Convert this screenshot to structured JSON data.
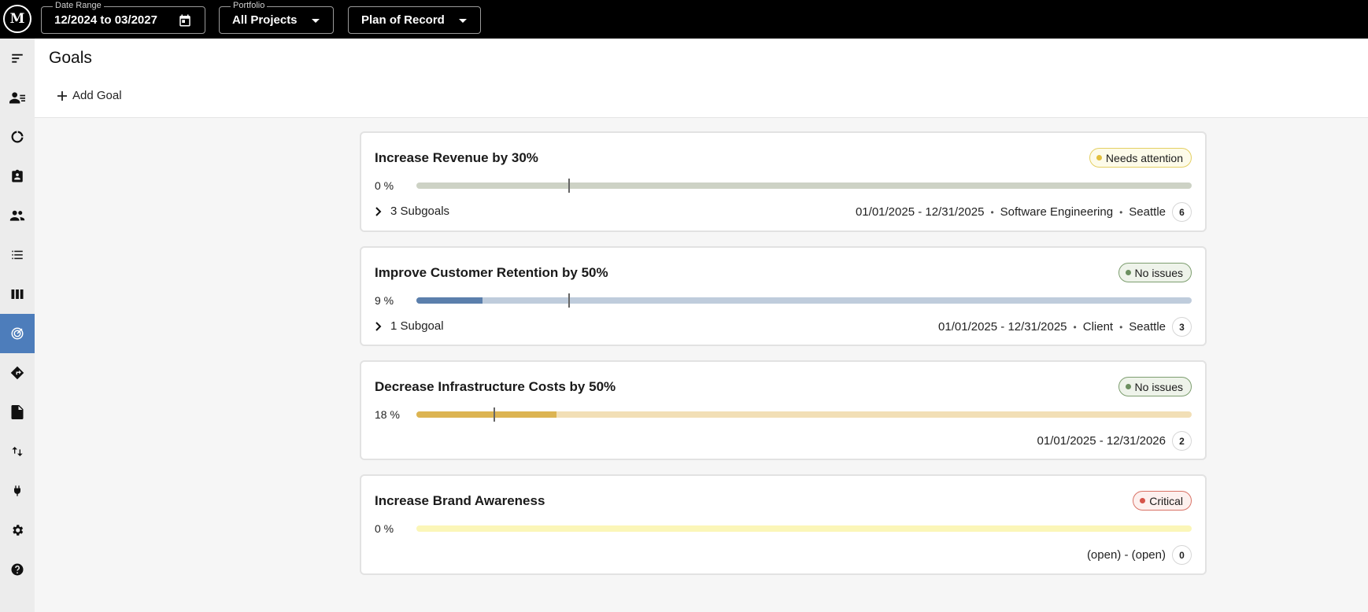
{
  "topbar": {
    "logo_text": "M",
    "date_range": {
      "legend": "Date Range",
      "value": "12/2024 to 03/2027",
      "icon": "calendar-icon"
    },
    "portfolio": {
      "legend": "Portfolio",
      "value": "All Projects",
      "icon": "dropdown-arrow-icon"
    },
    "plan": {
      "value": "Plan of Record",
      "icon": "dropdown-arrow-icon"
    }
  },
  "sidebar": {
    "items": [
      {
        "name": "menu-icon"
      },
      {
        "name": "people-list-icon"
      },
      {
        "name": "donut-chart-icon"
      },
      {
        "name": "clipboard-icon"
      },
      {
        "name": "team-icon"
      },
      {
        "name": "list-icon"
      },
      {
        "name": "columns-icon"
      },
      {
        "name": "goals-icon",
        "active": true
      },
      {
        "name": "roadmap-icon"
      },
      {
        "name": "document-icon"
      },
      {
        "name": "sort-icon"
      },
      {
        "name": "plug-icon"
      },
      {
        "name": "settings-icon"
      },
      {
        "name": "help-icon"
      }
    ],
    "active_color": "#4d7dbb"
  },
  "header": {
    "title": "Goals",
    "add_goal_label": "Add Goal"
  },
  "goals": [
    {
      "title": "Increase Revenue by 30%",
      "status": "Needs attention",
      "status_bg": "#fdfbe9",
      "status_border": "#e4cf63",
      "status_dot": "#e2bf3c",
      "progress_label": "0 %",
      "progress": 0,
      "marker": 0.196,
      "bar_track": "#cdd2c5",
      "bar_fill": "#9fae94",
      "subgoals": "3 Subgoals",
      "dates": "01/01/2025 - 12/31/2025",
      "department": "Software Engineering",
      "location": "Seattle",
      "count": "6"
    },
    {
      "title": "Improve Customer Retention by 50%",
      "status": "No issues",
      "status_bg": "#eef3ea",
      "status_border": "#7d9e6f",
      "status_dot": "#6c8f60",
      "progress_label": "9 %",
      "progress": 0.085,
      "marker": 0.196,
      "bar_track": "#bfccdc",
      "bar_fill": "#5b7fac",
      "subgoals": "1 Subgoal",
      "dates": "01/01/2025 - 12/31/2025",
      "department": "Client",
      "location": "Seattle",
      "count": "3"
    },
    {
      "title": "Decrease Infrastructure Costs by 50%",
      "status": "No issues",
      "status_bg": "#eef3ea",
      "status_border": "#7d9e6f",
      "status_dot": "#6c8f60",
      "progress_label": "18 %",
      "progress": 0.181,
      "marker": 0.099,
      "bar_track": "#f2dfb6",
      "bar_fill": "#dcb452",
      "subgoals": "",
      "dates": "01/01/2025 - 12/31/2026",
      "department": "",
      "location": "",
      "count": "2"
    },
    {
      "title": "Increase Brand Awareness",
      "status": "Critical",
      "status_bg": "#fdf0ee",
      "status_border": "#d97266",
      "status_dot": "#d5544a",
      "progress_label": "0 %",
      "progress": 0,
      "marker": null,
      "bar_track": "#fbf6b8",
      "bar_fill": "#f2e88a",
      "subgoals": "",
      "dates": "(open) - (open)",
      "department": "",
      "location": "",
      "count": "0"
    }
  ]
}
